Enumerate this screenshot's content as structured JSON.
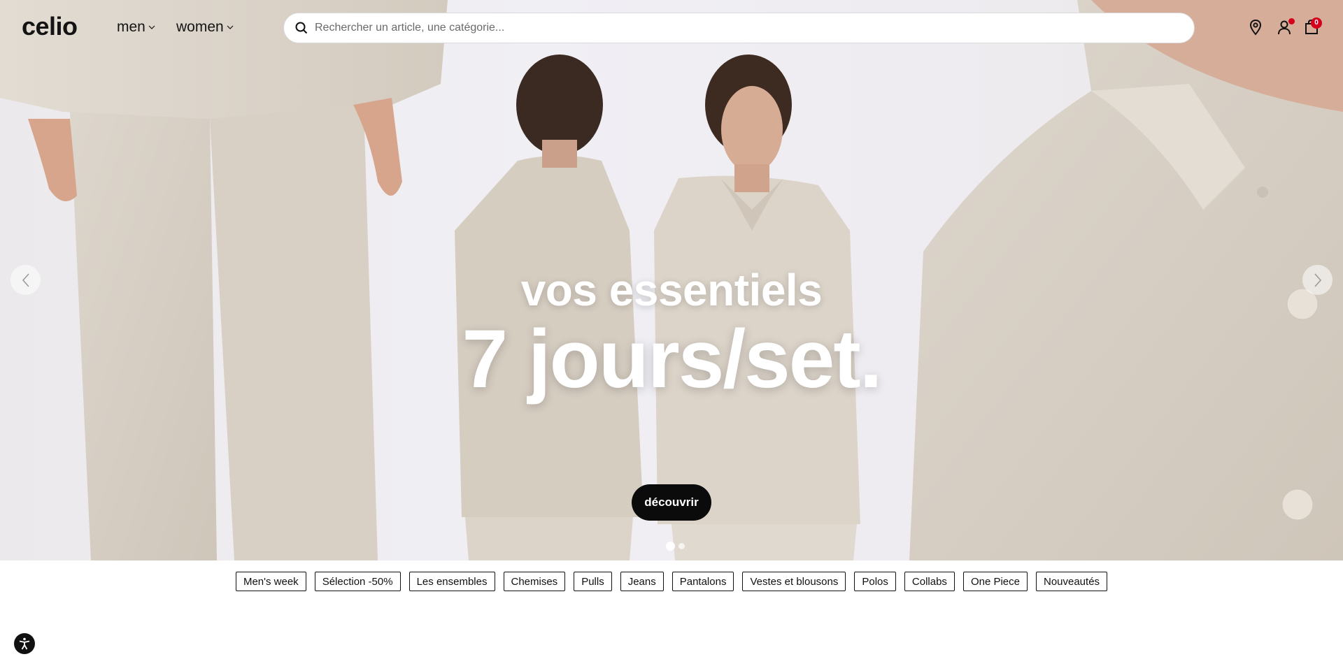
{
  "header": {
    "logo": "celio",
    "nav": [
      {
        "label": "men"
      },
      {
        "label": "women"
      }
    ],
    "search": {
      "placeholder": "Rechercher un article, une catégorie..."
    },
    "cart_count": "0"
  },
  "hero": {
    "subtitle": "vos essentiels",
    "title": "7 jours/set.",
    "cta_label": "découvrir",
    "slides_total": 2,
    "active_slide": 1
  },
  "categories": [
    "Men's week",
    "Sélection -50%",
    "Les ensembles",
    "Chemises",
    "Pulls",
    "Jeans",
    "Pantalons",
    "Vestes et blousons",
    "Polos",
    "Collabs",
    "One Piece",
    "Nouveautés"
  ],
  "colors": {
    "brand_text": "#141414",
    "badge": "#d5001c",
    "cta_bg": "#0b0b0b",
    "garment": "#d9d1c6"
  },
  "icons": [
    "search-icon",
    "store-locator-icon",
    "account-icon",
    "bag-icon",
    "chevron-left-icon",
    "chevron-right-icon",
    "accessibility-icon"
  ]
}
